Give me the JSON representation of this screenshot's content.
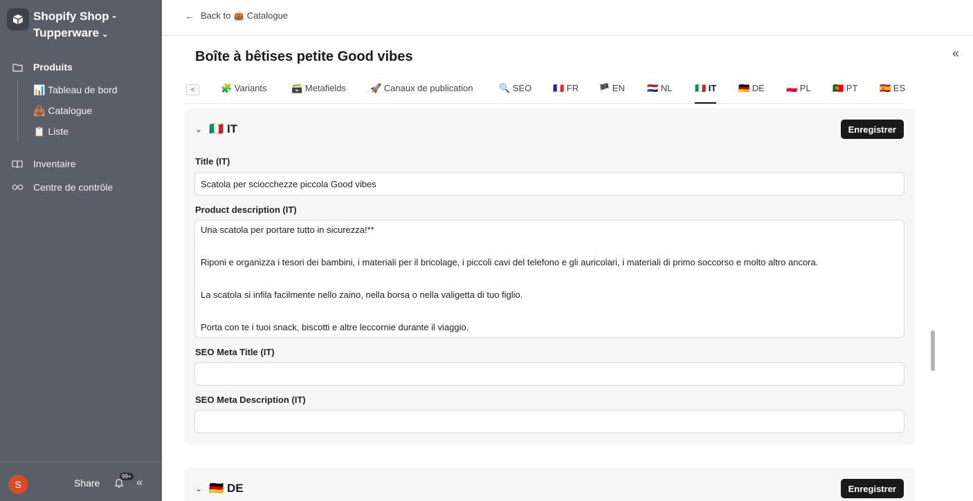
{
  "workspace": {
    "name": "Shopify Shop - Tupperware"
  },
  "nav": {
    "produits": "Produits",
    "sub": [
      {
        "emoji": "📊",
        "label": "Tableau de bord"
      },
      {
        "emoji": "👜",
        "label": "Catalogue"
      },
      {
        "emoji": "📋",
        "label": "Liste"
      }
    ],
    "inventaire": "Inventaire",
    "centre": "Centre de contrôle"
  },
  "footer": {
    "avatar": "S",
    "share": "Share",
    "badge": "99+"
  },
  "topbar": {
    "back": "Back to 👜 Catalogue"
  },
  "page": {
    "title": "Boîte à bêtises petite Good vibes"
  },
  "tabs": [
    "🧩 Variants",
    "🗃️ Metafields",
    "🚀 Canaux de publication",
    "🔍 SEO",
    "🇫🇷 FR",
    "🏴 EN",
    "🇳🇱 NL",
    "🇮🇹 IT",
    "🇩🇪 DE",
    "🇵🇱 PL",
    "🇵🇹 PT",
    "🇪🇸 ES"
  ],
  "active_tab": "🇮🇹 IT",
  "section_it": {
    "title": "🇮🇹 IT",
    "save": "Enregistrer",
    "title_label": "Title (IT)",
    "title_value": "Scatola per sciocchezze piccola Good vibes",
    "desc_label": "Product description (IT)",
    "desc_lines": [
      "Una scatola per portare tutto in sicurezza!**",
      "Riponi e organizza i tesori dei bambini, i materiali per il bricolage, i piccoli cavi del telefono e gli auricolari, i materiali di primo soccorso e molto altro ancora.",
      "La scatola si infila facilmente nello zaino, nella borsa o nella valigetta di tuo figlio.",
      "Porta con te i tuoi snack, biscotti e altre leccornie durante il viaggio."
    ],
    "seo_title_label": "SEO Meta Title (IT)",
    "seo_title_value": "",
    "seo_desc_label": "SEO Meta Description (IT)",
    "seo_desc_value": ""
  },
  "section_de": {
    "title": "🇩🇪 DE",
    "save": "Enregistrer"
  }
}
